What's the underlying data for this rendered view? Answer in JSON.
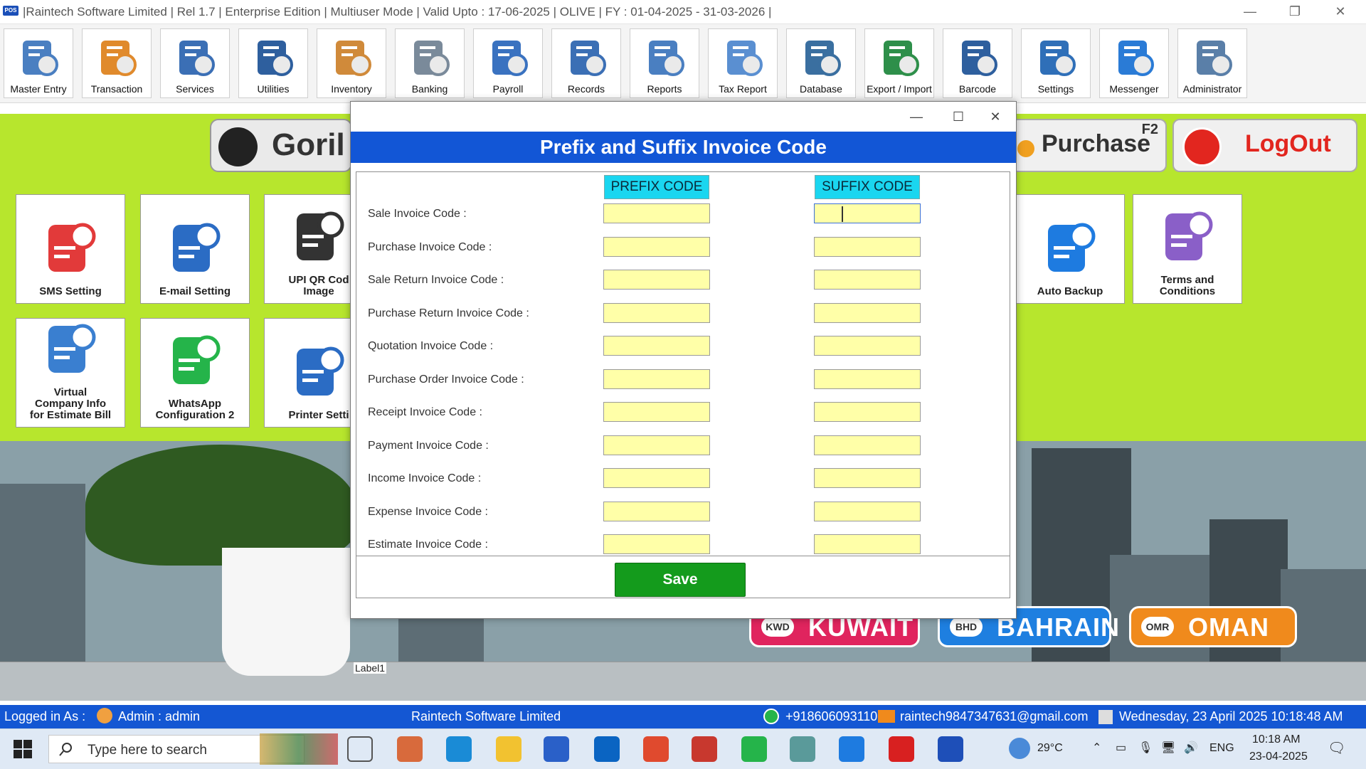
{
  "window": {
    "title": "|Raintech Software Limited |  Rel 1.7  |  Enterprise Edition  |  Multiuser Mode  |  Valid Upto : 17-06-2025  |  OLIVE  |  FY : 01-04-2025  -  31-03-2026  |",
    "logo_text": "POS",
    "minimize_glyph": "—",
    "restore_glyph": "❐",
    "close_glyph": "✕"
  },
  "toolbar": [
    {
      "label": "Master Entry",
      "icon": "master-entry-icon",
      "color": "#4a7fc1"
    },
    {
      "label": "Transaction",
      "icon": "transaction-icon",
      "color": "#e08a2c"
    },
    {
      "label": "Services",
      "icon": "services-icon",
      "color": "#3b6fb5"
    },
    {
      "label": "Utilities",
      "icon": "utilities-icon",
      "color": "#2e5f9e"
    },
    {
      "label": "Inventory",
      "icon": "inventory-icon",
      "color": "#d08a3a"
    },
    {
      "label": "Banking",
      "icon": "banking-icon",
      "color": "#7a8a9a"
    },
    {
      "label": "Payroll",
      "icon": "payroll-icon",
      "color": "#3a72c0"
    },
    {
      "label": "Records",
      "icon": "records-icon",
      "color": "#3b6fb5"
    },
    {
      "label": "Reports",
      "icon": "reports-icon",
      "color": "#4a7fc1"
    },
    {
      "label": "Tax Report",
      "icon": "tax-report-icon",
      "color": "#5a8fd1"
    },
    {
      "label": "Database",
      "icon": "database-icon",
      "color": "#3a6fa0"
    },
    {
      "label": "Export / Import",
      "icon": "export-import-icon",
      "color": "#2e8f4a"
    },
    {
      "label": "Barcode",
      "icon": "barcode-icon",
      "color": "#2e5f9e"
    },
    {
      "label": "Settings",
      "icon": "settings-icon",
      "color": "#2f6fb8"
    },
    {
      "label": "Messenger",
      "icon": "messenger-icon",
      "color": "#2a7bd6"
    },
    {
      "label": "Administrator",
      "icon": "administrator-icon",
      "color": "#5a7fa8"
    }
  ],
  "background": {
    "gorilla_text": "Goril",
    "purchase": {
      "label": "Purchase",
      "shortcut": "F2"
    },
    "logout": {
      "label": "LogOut"
    },
    "tiles": [
      {
        "label": "SMS Setting",
        "icon": "sms-setting-icon",
        "color": "#e23a3a"
      },
      {
        "label": "E-mail Setting",
        "icon": "email-setting-icon",
        "color": "#2b6cc4"
      },
      {
        "label": "UPI QR Cod\nImage",
        "icon": "upi-qr-icon",
        "color": "#333333"
      },
      {
        "label": "Virtual\nCompany Info\nfor Estimate Bill",
        "icon": "virtual-company-icon",
        "color": "#3a7fd0"
      },
      {
        "label": "WhatsApp\nConfiguration 2",
        "icon": "whatsapp-icon",
        "color": "#25b44a"
      },
      {
        "label": "Printer Setti",
        "icon": "printer-icon",
        "color": "#2b6cc4"
      },
      {
        "label": "Auto Backup",
        "icon": "cloud-upload-icon",
        "color": "#1e7be0"
      },
      {
        "label": "Terms and\nConditions",
        "icon": "terms-icon",
        "color": "#8a5fc8"
      }
    ],
    "countries": [
      {
        "code": "KWD",
        "name": "KUWAIT",
        "color": "#e0245e"
      },
      {
        "code": "BHD",
        "name": "BAHRAIN",
        "color": "#1e7fe0"
      },
      {
        "code": "OMR",
        "name": "OMAN",
        "color": "#f08a1c"
      }
    ],
    "label1": "Label1"
  },
  "dialog": {
    "title": "Prefix and Suffix Invoice Code",
    "prefix_header": "PREFIX CODE",
    "suffix_header": "SUFFIX CODE",
    "rows": [
      {
        "label": "Sale Invoice Code :",
        "prefix": "",
        "suffix": ""
      },
      {
        "label": "Purchase Invoice Code :",
        "prefix": "",
        "suffix": ""
      },
      {
        "label": "Sale Return Invoice Code :",
        "prefix": "",
        "suffix": ""
      },
      {
        "label": "Purchase Return Invoice Code :",
        "prefix": "",
        "suffix": ""
      },
      {
        "label": "Quotation Invoice Code :",
        "prefix": "",
        "suffix": ""
      },
      {
        "label": "Purchase Order Invoice Code :",
        "prefix": "",
        "suffix": ""
      },
      {
        "label": "Receipt Invoice Code :",
        "prefix": "",
        "suffix": ""
      },
      {
        "label": "Payment Invoice Code :",
        "prefix": "",
        "suffix": ""
      },
      {
        "label": "Income Invoice Code :",
        "prefix": "",
        "suffix": ""
      },
      {
        "label": "Expense Invoice Code :",
        "prefix": "",
        "suffix": ""
      },
      {
        "label": "Estimate Invoice Code :",
        "prefix": "",
        "suffix": ""
      }
    ],
    "save_label": "Save",
    "focused_field": "Sale Invoice Code suffix"
  },
  "statusbar": {
    "logged_in_prefix": "Logged in As :",
    "user": "Admin  :  admin",
    "company": "Raintech Software Limited",
    "phone": "+918606093110",
    "email": "raintech9847347631@gmail.com",
    "datetime": "Wednesday, 23 April 2025 10:18:48 AM"
  },
  "taskbar": {
    "search_placeholder": "Type here to search",
    "weather": "29°C",
    "language": "ENG",
    "time": "10:18 AM",
    "date": "23-04-2025",
    "pinned_apps": [
      {
        "name": "task-view-icon",
        "color": "#555555"
      },
      {
        "name": "copilot-icon",
        "color": "#d86a3c"
      },
      {
        "name": "edge-icon",
        "color": "#1a8bd6"
      },
      {
        "name": "file-explorer-icon",
        "color": "#f2c230"
      },
      {
        "name": "store-icon",
        "color": "#2a60c8"
      },
      {
        "name": "outlook-icon",
        "color": "#0a64c2"
      },
      {
        "name": "chrome-icon",
        "color": "#e04a2e"
      },
      {
        "name": "snipping-tool-icon",
        "color": "#c8382e"
      },
      {
        "name": "whatsapp-taskbar-icon",
        "color": "#25b44a"
      },
      {
        "name": "notes-icon",
        "color": "#5a9a9a"
      },
      {
        "name": "telegram-icon",
        "color": "#1e7be0"
      },
      {
        "name": "recorder-icon",
        "color": "#d82020"
      },
      {
        "name": "raintech-app-icon",
        "color": "#1e4fb8"
      }
    ]
  }
}
